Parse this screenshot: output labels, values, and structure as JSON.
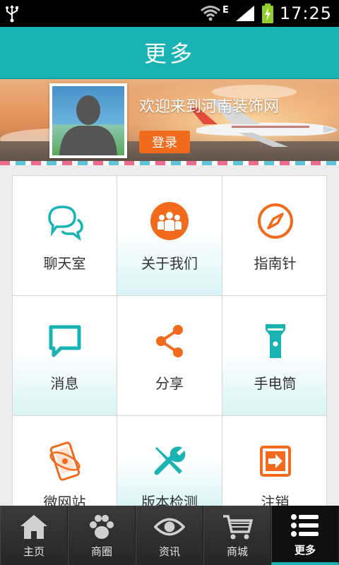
{
  "status_bar": {
    "time": "17:25",
    "network_type": "E",
    "icons": [
      "usb-icon",
      "wifi-icon",
      "signal-icon",
      "battery-charging-icon"
    ]
  },
  "header": {
    "title": "更多"
  },
  "banner": {
    "welcome_text": "欢迎来到河南装饰网",
    "login_label": "登录",
    "avatar_icon": "user-silhouette-icon"
  },
  "colors": {
    "header_bg": "#1ab3b4",
    "accent_orange": "#f26b1d",
    "accent_teal": "#1ab3b4"
  },
  "grid_items": [
    {
      "label": "聊天室",
      "icon": "chat-bubbles-icon"
    },
    {
      "label": "关于我们",
      "icon": "group-icon"
    },
    {
      "label": "指南针",
      "icon": "compass-icon"
    },
    {
      "label": "消息",
      "icon": "message-icon"
    },
    {
      "label": "分享",
      "icon": "share-icon"
    },
    {
      "label": "手电筒",
      "icon": "flashlight-icon"
    },
    {
      "label": "微网站",
      "icon": "mobile-site-icon"
    },
    {
      "label": "版本检测",
      "icon": "tools-icon"
    },
    {
      "label": "注销",
      "icon": "logout-icon"
    }
  ],
  "tab_bar": {
    "items": [
      {
        "label": "主页",
        "icon": "home-icon"
      },
      {
        "label": "商圈",
        "icon": "paw-icon"
      },
      {
        "label": "资讯",
        "icon": "eye-icon"
      },
      {
        "label": "商城",
        "icon": "cart-icon"
      },
      {
        "label": "更多",
        "icon": "list-icon"
      }
    ],
    "active": "更多"
  }
}
